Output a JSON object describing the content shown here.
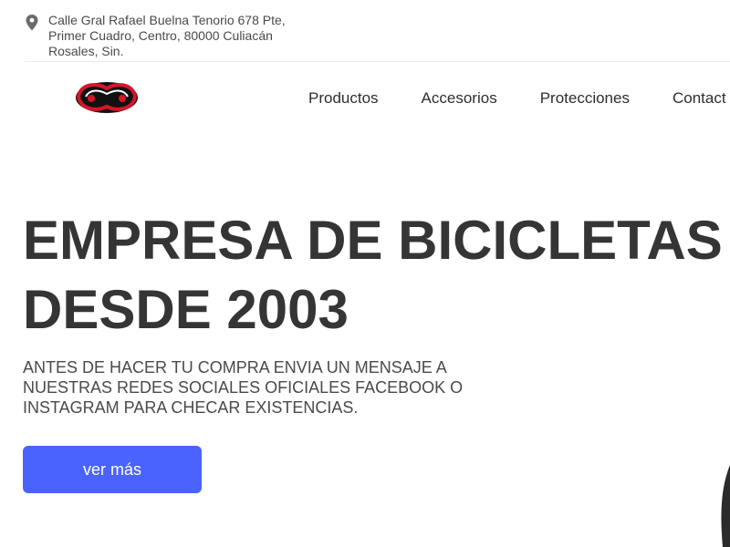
{
  "header": {
    "address": "Calle Gral Rafael Buelna Tenorio 678 Pte, Primer Cuadro, Centro, 80000 Culiacán Rosales, Sin."
  },
  "nav": {
    "items": [
      {
        "label": "Productos"
      },
      {
        "label": "Accesorios"
      },
      {
        "label": "Protecciones"
      },
      {
        "label": "Contact"
      }
    ]
  },
  "hero": {
    "headline_line1": "EMPRESA DE BICICLETAS",
    "headline_line2": "DESDE 2003",
    "subtext": "ANTES DE HACER TU COMPRA ENVIA UN MENSAJE A NUESTRAS REDES SOCIALES OFICIALES  FACEBOOK O INSTAGRAM  PARA CHECAR EXISTENCIAS.",
    "cta_label": "ver más"
  },
  "colors": {
    "accent": "#4a63ff",
    "heading": "#353535",
    "logo_red": "#d8142a"
  },
  "icons": {
    "address": "map-pin-icon",
    "logo": "brand-logo"
  }
}
